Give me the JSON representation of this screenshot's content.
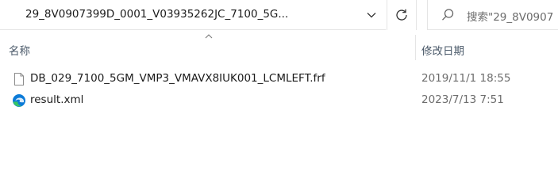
{
  "address_bar": {
    "path": "29_8V0907399D_0001_V03935262JC_7100_5G..."
  },
  "search": {
    "placeholder": "搜索\"29_8V0907"
  },
  "icons": {
    "dropdown": "chevron-down-icon",
    "refresh": "refresh-icon",
    "search": "search-icon",
    "sort": "sort-ascending-icon",
    "frf_file": "document-icon",
    "xml_file": "edge-browser-icon"
  },
  "columns": {
    "name": "名称",
    "date_modified": "修改日期"
  },
  "files": [
    {
      "name": "DB_029_7100_5GM_VMP3_VMAVX8IUK001_LCMLEFT.frf",
      "date": "2019/11/1 18:55",
      "icon": "document-icon"
    },
    {
      "name": "result.xml",
      "date": "2023/7/13 7:51",
      "icon": "edge-browser-icon"
    }
  ]
}
